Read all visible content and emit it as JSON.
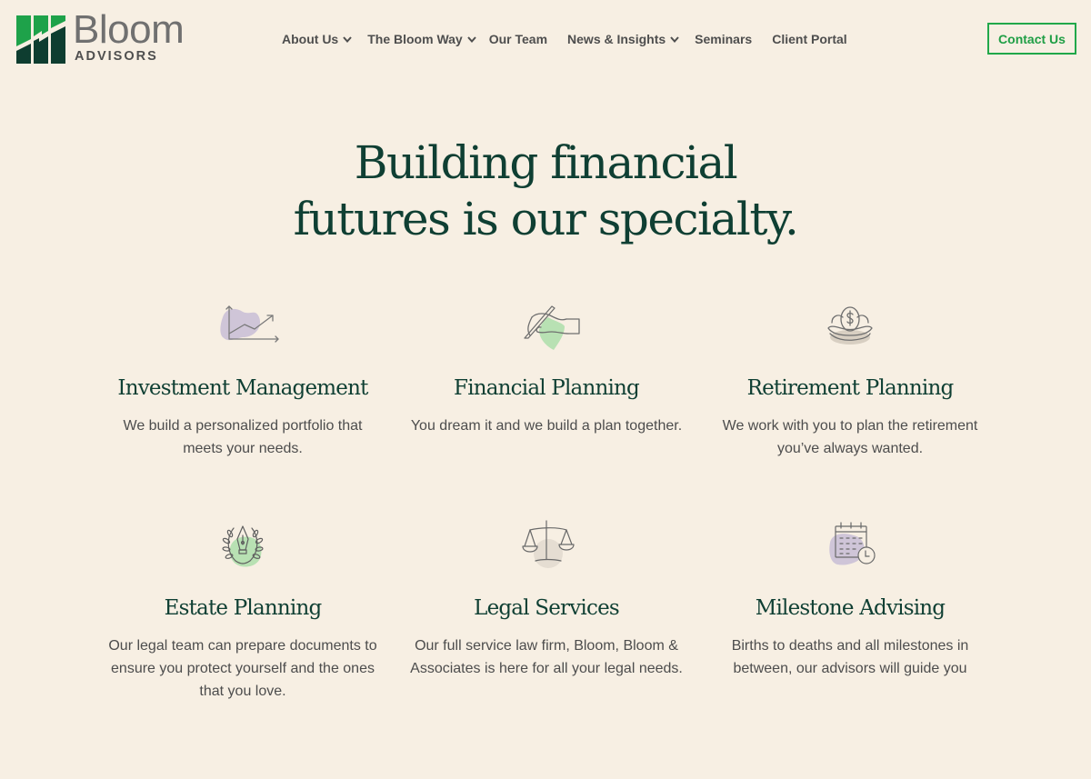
{
  "brand": {
    "name": "Bloom",
    "tagline": "ADVISORS",
    "colors": {
      "background": "#f7efe3",
      "logo_light_green": "#1ea24a",
      "logo_dark_green": "#0e3d30",
      "heading": "#0f3f33",
      "accent": "#21a84a",
      "text": "#4d4d4d"
    }
  },
  "nav": {
    "items": [
      {
        "label": "About Us",
        "has_dropdown": true,
        "icon": "chevron-down-icon"
      },
      {
        "label": "The Bloom Way",
        "has_dropdown": true,
        "icon": "chevron-down-icon"
      },
      {
        "label": "Our Team",
        "has_dropdown": false
      },
      {
        "label": "News & Insights",
        "has_dropdown": true,
        "icon": "chevron-down-icon"
      },
      {
        "label": "Seminars",
        "has_dropdown": false
      },
      {
        "label": "Client Portal",
        "has_dropdown": false
      }
    ],
    "cta_label": "Contact Us"
  },
  "hero": {
    "line1": "Building financial",
    "line2": "futures is our specialty."
  },
  "services": [
    {
      "title": "Investment Management",
      "description": "We build a personalized portfolio that meets your needs.",
      "icon": "growth-chart-icon"
    },
    {
      "title": "Financial Planning",
      "description": "You dream it and we build a plan together.",
      "icon": "hand-signing-icon"
    },
    {
      "title": "Retirement Planning",
      "description": "We work with you to plan the retirement you’ve always wanted.",
      "icon": "nest-egg-icon"
    },
    {
      "title": "Estate Planning",
      "description": "Our legal team can prepare documents to ensure you protect yourself and the ones that you love.",
      "icon": "pen-laurel-icon"
    },
    {
      "title": "Legal Services",
      "description": "Our full service law firm, Bloom, Bloom & Associates is here for all your legal needs.",
      "icon": "scales-icon"
    },
    {
      "title": "Milestone Advising",
      "description": "Births to deaths and all milestones in between, our advisors will guide you",
      "icon": "calendar-clock-icon"
    }
  ]
}
